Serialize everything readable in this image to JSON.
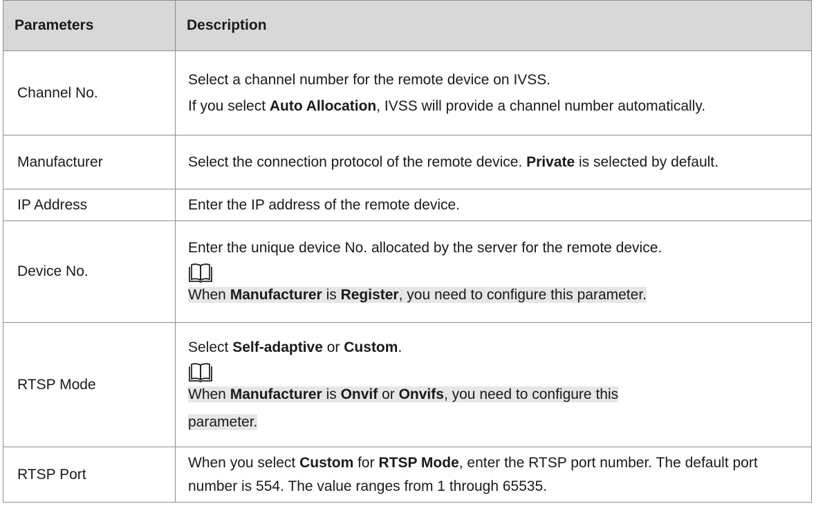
{
  "headers": {
    "param": "Parameters",
    "desc": "Description"
  },
  "rows": {
    "channel": {
      "param": "Channel No.",
      "line1": "Select a channel number for the remote device on IVSS.",
      "line2_pre": "If you select ",
      "line2_bold": "Auto Allocation",
      "line2_post": ", IVSS will provide a channel number automatically."
    },
    "manufacturer": {
      "param": "Manufacturer",
      "pre": "Select the connection protocol of the remote device. ",
      "bold": "Private",
      "post": " is selected by default."
    },
    "ip": {
      "param": "IP Address",
      "text": "Enter the IP address of the remote device."
    },
    "device": {
      "param": "Device No.",
      "line1": "Enter the unique device No. allocated by the server for the remote device.",
      "note_pre": "When ",
      "note_b1": "Manufacturer",
      "note_mid": " is ",
      "note_b2": "Register",
      "note_post": ", you need to configure this parameter."
    },
    "rtsp_mode": {
      "param": "RTSP Mode",
      "pre": "Select ",
      "b1": "Self-adaptive",
      "mid": " or ",
      "b2": "Custom",
      "post": ".",
      "note_pre": "When ",
      "note_b1": "Manufacturer",
      "note_mid1": " is ",
      "note_b2": "Onvif",
      "note_mid2": " or ",
      "note_b3": "Onvifs",
      "note_post1": ", you need to configure this",
      "note_post2": "parameter."
    },
    "rtsp_port": {
      "param": "RTSP Port",
      "pre": "When you select ",
      "b1": "Custom",
      "mid": " for ",
      "b2": "RTSP Mode",
      "post": ", enter the RTSP port number. The default port number is 554. The value ranges from 1 through 65535."
    }
  }
}
